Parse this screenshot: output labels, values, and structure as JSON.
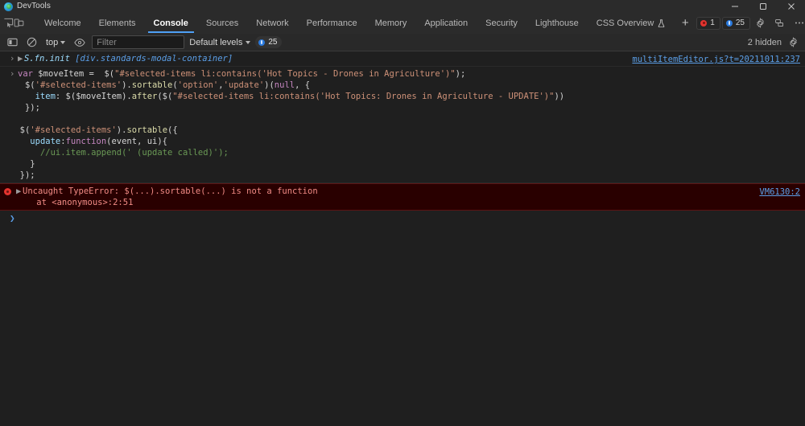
{
  "window": {
    "title": "DevTools",
    "app_icon": "devtools-icon",
    "controls": {
      "minimize": "minimize-icon",
      "restore": "restore-icon",
      "close": "close-icon"
    }
  },
  "tabbar": {
    "left_icons": [
      {
        "name": "inspect-element-icon"
      },
      {
        "name": "device-toolbar-icon"
      }
    ],
    "tabs": [
      {
        "label": "Welcome",
        "active": false
      },
      {
        "label": "Elements",
        "active": false
      },
      {
        "label": "Console",
        "active": true
      },
      {
        "label": "Sources",
        "active": false
      },
      {
        "label": "Network",
        "active": false
      },
      {
        "label": "Performance",
        "active": false
      },
      {
        "label": "Memory",
        "active": false
      },
      {
        "label": "Application",
        "active": false
      },
      {
        "label": "Security",
        "active": false
      },
      {
        "label": "Lighthouse",
        "active": false
      },
      {
        "label": "CSS Overview",
        "active": false,
        "icon": "beaker-icon"
      }
    ],
    "add_tab_label": "+",
    "error_badge": "1",
    "info_badge": "25",
    "settings_icon": "gear-icon",
    "customize_icon": "more-options-icon",
    "dock_icon": "dock-side-icon"
  },
  "console_toolbar": {
    "sidebar_icon": "console-sidebar-icon",
    "clear_icon": "clear-console-icon",
    "context": "top",
    "eye_icon": "live-expression-icon",
    "filter_placeholder": "Filter",
    "filter_value": "",
    "levels": "Default levels",
    "levels_count": "25",
    "hidden_text": "2 hidden",
    "settings_icon": "console-settings-icon"
  },
  "console": {
    "rows": [
      {
        "type": "object",
        "expand": "▶",
        "object_name": "S.fn.init",
        "object_sub": "[div.standards-modal-container]",
        "source": "multiItemEditor.js?t=20211011:237"
      },
      {
        "type": "input",
        "lines": [
          {
            "prompt": ">",
            "tokens": [
              {
                "t": "kw",
                "v": "var "
              },
              {
                "t": "pun",
                "v": "$moveItem =  "
              },
              {
                "t": "pun",
                "v": "$("
              },
              {
                "t": "str",
                "v": "\"#selected-items li:contains('Hot Topics - Drones in Agriculture')\""
              },
              {
                "t": "pun",
                "v": ");"
              }
            ]
          },
          {
            "prompt": "",
            "indent": 3,
            "tokens": [
              {
                "t": "pun",
                "v": "$("
              },
              {
                "t": "str",
                "v": "'#selected-items'"
              },
              {
                "t": "pun",
                "v": ")."
              },
              {
                "t": "fn",
                "v": "sortable"
              },
              {
                "t": "pun",
                "v": "("
              },
              {
                "t": "str",
                "v": "'option'"
              },
              {
                "t": "pun",
                "v": ","
              },
              {
                "t": "str",
                "v": "'update'"
              },
              {
                "t": "pun",
                "v": ")("
              },
              {
                "t": "kw",
                "v": "null"
              },
              {
                "t": "pun",
                "v": ", {"
              }
            ]
          },
          {
            "prompt": "",
            "indent": 5,
            "tokens": [
              {
                "t": "prop",
                "v": "item"
              },
              {
                "t": "pun",
                "v": ": $($moveItem)."
              },
              {
                "t": "fn",
                "v": "after"
              },
              {
                "t": "pun",
                "v": "($("
              },
              {
                "t": "str",
                "v": "\"#selected-items li:contains('Hot Topics: Drones in Agriculture - UPDATE')\""
              },
              {
                "t": "pun",
                "v": "))"
              }
            ]
          },
          {
            "prompt": "",
            "indent": 3,
            "tokens": [
              {
                "t": "pun",
                "v": "});"
              }
            ]
          },
          {
            "prompt": "",
            "indent": 0,
            "tokens": []
          },
          {
            "prompt": "",
            "indent": 2,
            "tokens": [
              {
                "t": "pun",
                "v": "$("
              },
              {
                "t": "str",
                "v": "'#selected-items'"
              },
              {
                "t": "pun",
                "v": ")."
              },
              {
                "t": "fn",
                "v": "sortable"
              },
              {
                "t": "pun",
                "v": "({"
              }
            ]
          },
          {
            "prompt": "",
            "indent": 4,
            "tokens": [
              {
                "t": "prop",
                "v": "update"
              },
              {
                "t": "pun",
                "v": ":"
              },
              {
                "t": "kw",
                "v": "function"
              },
              {
                "t": "pun",
                "v": "(event, ui){"
              }
            ]
          },
          {
            "prompt": "",
            "indent": 6,
            "tokens": [
              {
                "t": "com",
                "v": "//ui.item.append(' (update called)');"
              }
            ]
          },
          {
            "prompt": "",
            "indent": 4,
            "tokens": [
              {
                "t": "pun",
                "v": "}"
              }
            ]
          },
          {
            "prompt": "",
            "indent": 2,
            "tokens": [
              {
                "t": "pun",
                "v": "});"
              }
            ]
          }
        ]
      },
      {
        "type": "error",
        "expand": "▶",
        "message": "Uncaught TypeError: $(...).sortable(...) is not a function",
        "stack": "    at <anonymous>:2:51",
        "source": "VM6130:2"
      },
      {
        "type": "prompt",
        "chevron": "❯",
        "value": ""
      }
    ]
  },
  "colors": {
    "accent": "#4ea0f5",
    "error": "#e4342f",
    "info": "#2a7ade",
    "link": "#5b9fe8",
    "error_bg": "#290000",
    "window_bg": "#1f1f1f",
    "chrome_bg": "#2b2b2b"
  }
}
